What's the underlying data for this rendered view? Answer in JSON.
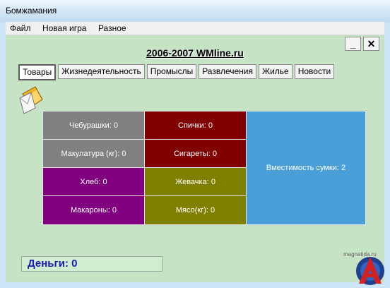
{
  "window": {
    "title": "Бомжамания"
  },
  "menu": [
    "Файл",
    "Новая игра",
    "Разное"
  ],
  "header": {
    "title": "2006-2007 WMline.ru"
  },
  "controls": {
    "minimize": "_",
    "close": "✕"
  },
  "tabs": [
    "Товары",
    "Жизнедеятельность",
    "Промыслы",
    "Развлечения",
    "Жилье",
    "Новости"
  ],
  "active_tab": "Товары",
  "goods": [
    {
      "label": "Чебурашки: 0",
      "color": "#808080"
    },
    {
      "label": "Спички: 0",
      "color": "#800000"
    },
    {
      "label": "Макулатура (кг): 0",
      "color": "#808080"
    },
    {
      "label": "Сигареты: 0",
      "color": "#800000"
    },
    {
      "label": "Хлеб: 0",
      "color": "#800080"
    },
    {
      "label": "Жевачка: 0",
      "color": "#808000"
    },
    {
      "label": "Макароны: 0",
      "color": "#800080"
    },
    {
      "label": "Мясо(кг): 0",
      "color": "#808000"
    }
  ],
  "capacity": {
    "label": "Вместимость сумки: 2",
    "color": "#4a9fd8"
  },
  "money": {
    "label": "Деньги: 0"
  },
  "watermark": "magnatida.ru"
}
